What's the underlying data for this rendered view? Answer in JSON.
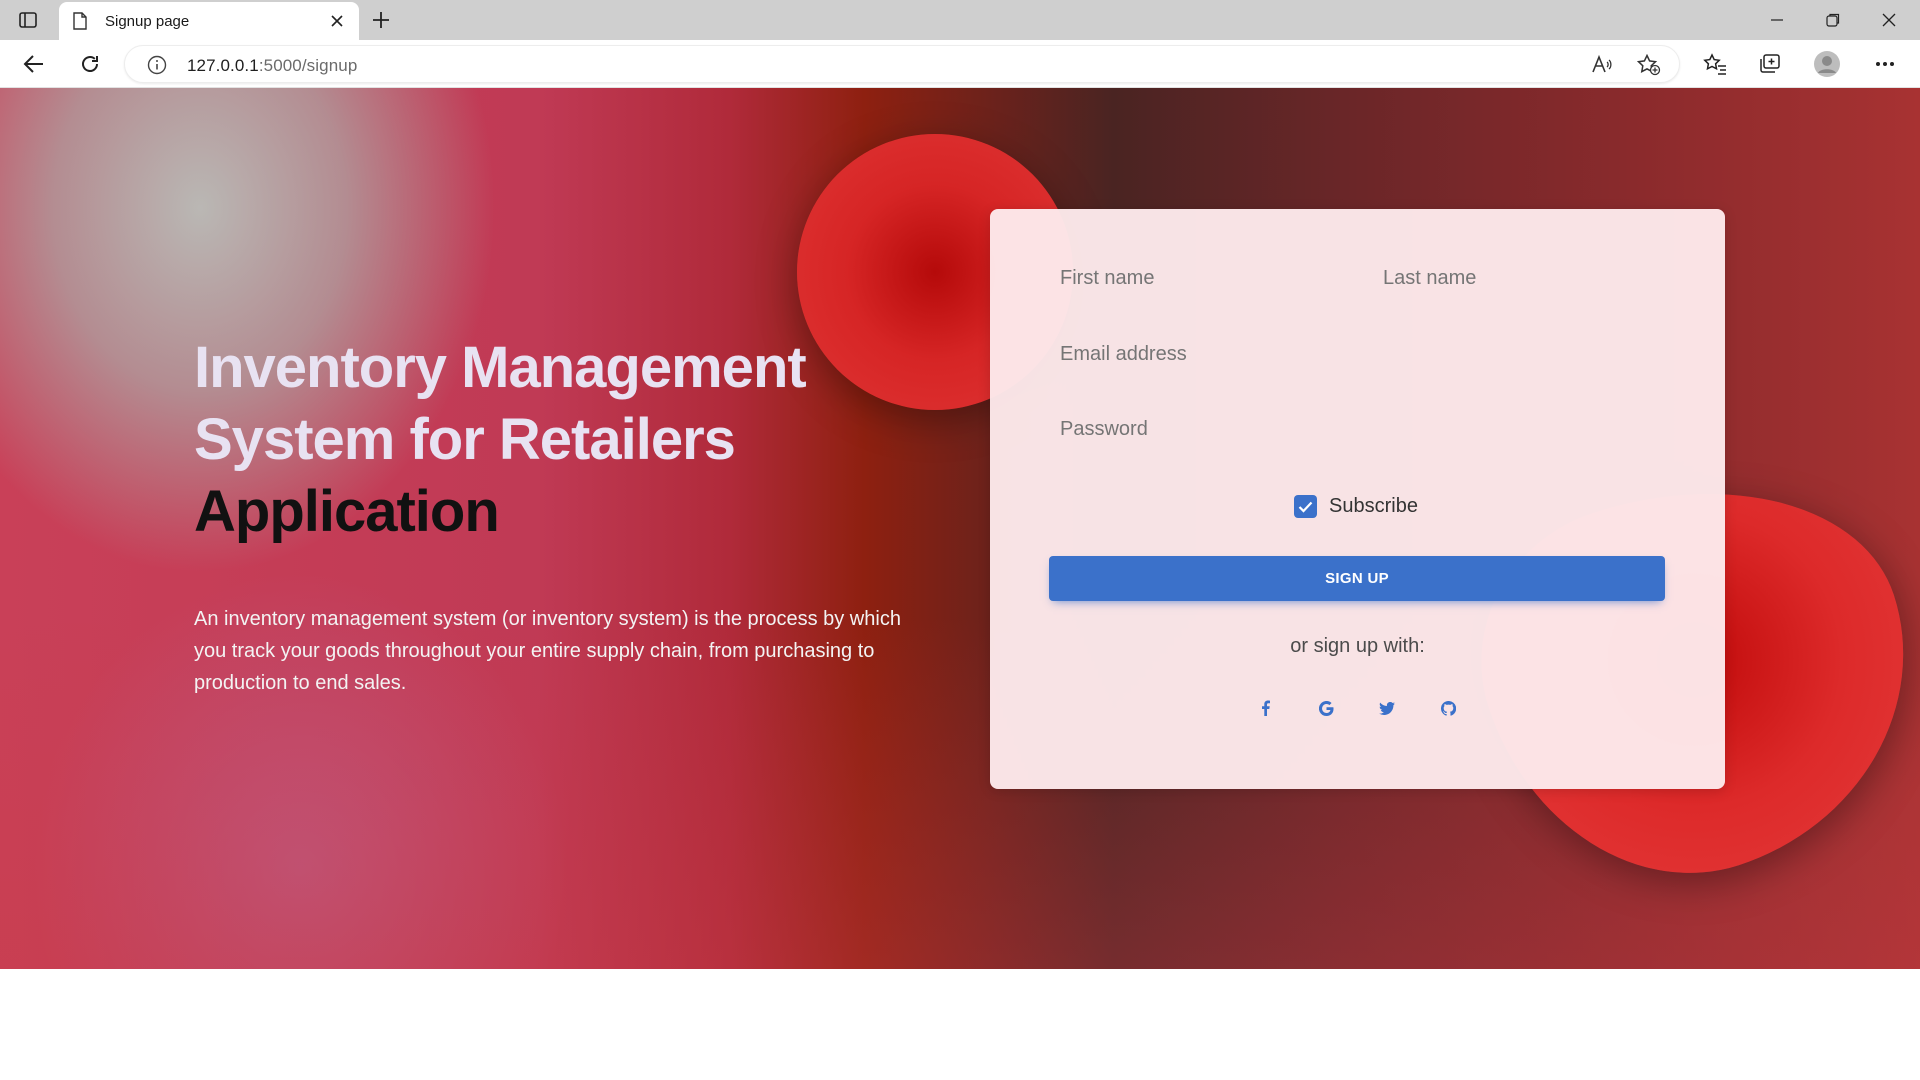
{
  "browser": {
    "tab_title": "Signup page",
    "url_host": "127.0.0.1",
    "url_rest": ":5000/signup",
    "icons": [
      "tab-actions-icon",
      "page-icon",
      "close-icon",
      "plus-icon",
      "minimize-icon",
      "restore-icon",
      "window-close-icon",
      "back-icon",
      "refresh-icon",
      "info-icon",
      "read-aloud-icon",
      "add-favorite-icon",
      "favorites-icon",
      "collections-icon",
      "profile-icon",
      "more-icon"
    ]
  },
  "hero": {
    "headline_line1": "Inventory Management",
    "headline_line2": "System for Retailers",
    "headline_line3": "Application",
    "description": "An inventory management system (or inventory system) is the process by which you track your goods throughout your entire supply chain, from purchasing to production to end sales."
  },
  "form": {
    "first_name_placeholder": "First name",
    "last_name_placeholder": "Last name",
    "email_placeholder": "Email address",
    "password_placeholder": "Password",
    "subscribe_label": "Subscribe",
    "subscribe_checked": true,
    "submit_label": "SIGN UP",
    "alt_signup_text": "or sign up with:",
    "social": [
      "facebook-icon",
      "google-icon",
      "twitter-icon",
      "github-icon"
    ]
  },
  "colors": {
    "accent": "#3b71ca",
    "card_bg": "#fde9eb",
    "headline_light": "#e8e2f2",
    "headline_dark": "#111111"
  }
}
